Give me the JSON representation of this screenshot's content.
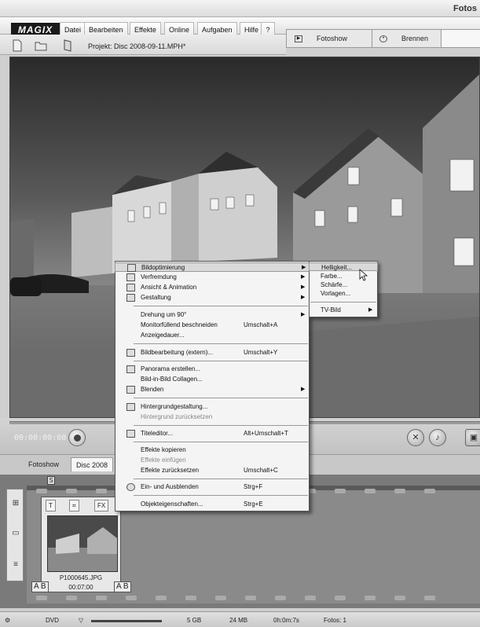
{
  "window": {
    "title": "Fotos"
  },
  "menubar": {
    "logo": "MAGIX",
    "items": [
      "Datei",
      "Bearbeiten",
      "Effekte",
      "Online",
      "Aufgaben",
      "Hilfe"
    ]
  },
  "mode_tabs": [
    {
      "label": "Fotoshow",
      "icon": "play-icon"
    },
    {
      "label": "Brennen",
      "icon": "burn-icon"
    }
  ],
  "toolbar": {
    "project_label": "Projekt: Disc 2008-09-11.MPH*"
  },
  "transport": {
    "time": "00:00:00:00"
  },
  "tabs": [
    {
      "label": "Fotoshow"
    },
    {
      "label": "Disc 2008"
    }
  ],
  "storyboard": {
    "segment_marker": "S",
    "clip": {
      "name": "P1000645.JPG",
      "duration": "00:07:00",
      "icons": [
        "T",
        "FX"
      ],
      "transition_in": "A B",
      "transition_out": "A B"
    }
  },
  "statusbar": {
    "disc_type": "DVD",
    "capacity": "5 GB",
    "used": "24 MB",
    "duration": "0h:0m:7s",
    "photos": "Fotos: 1"
  },
  "context_menu": {
    "groups": [
      [
        {
          "label": "Bildoptimierung",
          "submenu": true,
          "highlighted": true,
          "icon": "optimize-icon"
        },
        {
          "label": "Verfremdung",
          "submenu": true,
          "icon": "alienate-icon"
        },
        {
          "label": "Ansicht & Animation",
          "submenu": true,
          "icon": "animation-icon"
        },
        {
          "label": "Gestaltung",
          "submenu": true,
          "icon": "design-icon"
        }
      ],
      [
        {
          "label": "Drehung um 90°",
          "submenu": true
        },
        {
          "label": "Monitorfüllend beschneiden",
          "shortcut": "Umschalt+A"
        },
        {
          "label": "Anzeigedauer..."
        }
      ],
      [
        {
          "label": "Bildbearbeitung (extern)...",
          "shortcut": "Umschalt+Y",
          "icon": "edit-external-icon"
        }
      ],
      [
        {
          "label": "Panorama erstellen...",
          "icon": "panorama-icon"
        },
        {
          "label": "Bild-in-Bild Collagen..."
        },
        {
          "label": "Blenden",
          "submenu": true,
          "icon": "blend-icon"
        }
      ],
      [
        {
          "label": "Hintergrundgestaltung...",
          "icon": "background-icon"
        },
        {
          "label": "Hintergrund zurücksetzen",
          "disabled": true
        }
      ],
      [
        {
          "label": "Titeleditor...",
          "shortcut": "Alt+Umschalt+T",
          "icon": "title-editor-icon"
        }
      ],
      [
        {
          "label": "Effekte kopieren"
        },
        {
          "label": "Effekte einfügen",
          "disabled": true
        },
        {
          "label": "Effekte zurücksetzen",
          "shortcut": "Umschalt+C"
        }
      ],
      [
        {
          "label": "Ein- und Ausblenden",
          "shortcut": "Strg+F",
          "icon": "fade-icon"
        }
      ],
      [
        {
          "label": "Objekteigenschaften...",
          "shortcut": "Strg+E"
        }
      ]
    ]
  },
  "submenu": {
    "items": [
      {
        "label": "Helligkeit...",
        "highlighted": true
      },
      {
        "label": "Farbe..."
      },
      {
        "label": "Schärfe..."
      },
      {
        "label": "Vorlagen..."
      },
      {
        "label": "TV-Bild",
        "submenu": true
      }
    ]
  }
}
